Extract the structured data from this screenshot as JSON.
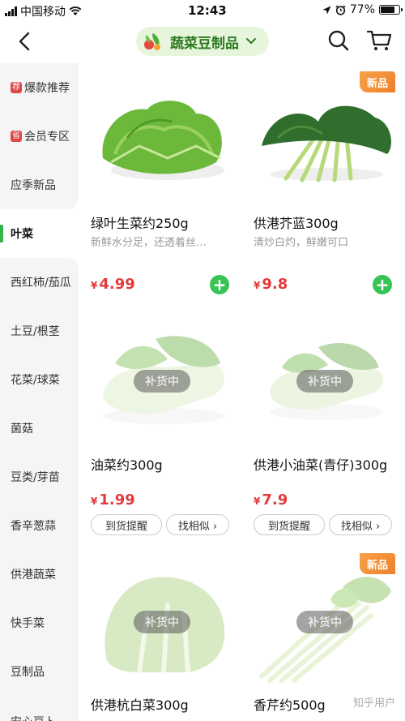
{
  "status_bar": {
    "carrier": "中国移动",
    "time": "12:43",
    "battery": "77%",
    "battery_level": 0.77
  },
  "nav": {
    "category": "蔬菜豆制品"
  },
  "sidebar": {
    "items": [
      {
        "label": "爆款推荐",
        "tag": "荐"
      },
      {
        "label": "会员专区",
        "tag": "省"
      },
      {
        "label": "应季新品"
      },
      {
        "label": "叶菜"
      },
      {
        "label": "西红柿/茄瓜"
      },
      {
        "label": "土豆/根茎"
      },
      {
        "label": "花菜/球菜"
      },
      {
        "label": "菌菇"
      },
      {
        "label": "豆类/芽苗"
      },
      {
        "label": "香辛葱蒜"
      },
      {
        "label": "供港蔬菜"
      },
      {
        "label": "快手菜"
      },
      {
        "label": "豆制品"
      },
      {
        "label": "安心豆卜"
      }
    ]
  },
  "products": [
    {
      "name": "绿叶生菜约250g",
      "desc": "新鲜水分足，还透着丝…",
      "price": "4.99",
      "currency": "¥"
    },
    {
      "name": "供港芥蓝300g",
      "desc": "清炒白灼，鲜嫩可口",
      "price": "9.8",
      "currency": "¥",
      "badge": "新品"
    },
    {
      "name": "油菜约300g",
      "price": "1.99",
      "currency": "¥",
      "status": "补货中",
      "remind": "到货提醒",
      "similar": "找相似 ›"
    },
    {
      "name": "供港小油菜(青仔)300g",
      "price": "7.9",
      "currency": "¥",
      "status": "补货中",
      "remind": "到货提醒",
      "similar": "找相似 ›"
    },
    {
      "name": "供港杭白菜300g",
      "status": "补货中"
    },
    {
      "name": "香芹约500g",
      "status": "补货中",
      "badge": "新品"
    }
  ],
  "watermark": "知乎用户",
  "colors": {
    "accent_green": "#37b44a",
    "price_red": "#e23b3b",
    "badge_orange": "#ef7f2a"
  }
}
